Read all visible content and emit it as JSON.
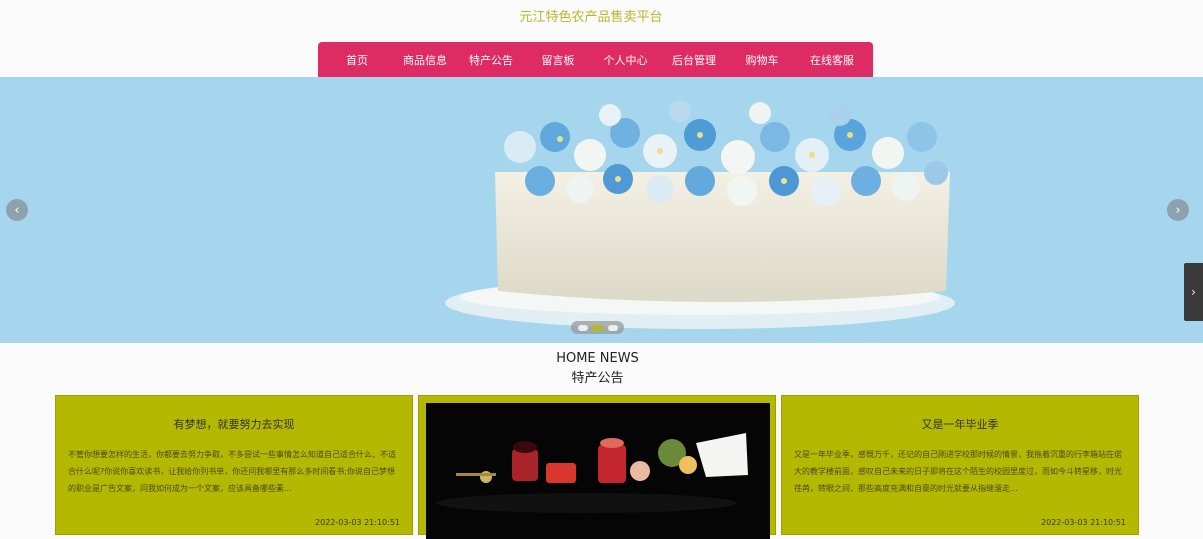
{
  "site": {
    "title": "元江特色农产品售卖平台"
  },
  "nav": {
    "items": [
      {
        "label": "首页"
      },
      {
        "label": "商品信息"
      },
      {
        "label": "特产公告"
      },
      {
        "label": "留言板"
      },
      {
        "label": "个人中心"
      },
      {
        "label": "后台管理"
      },
      {
        "label": "购物车"
      },
      {
        "label": "在线客服"
      }
    ]
  },
  "banner": {
    "prev_icon": "chevron-left-icon",
    "next_icon": "chevron-right-icon",
    "slide_count": 3,
    "active_slide": 2
  },
  "side_tab": {
    "icon": "chevron-right-icon"
  },
  "section": {
    "heading_en": "HOME NEWS",
    "heading_cn": "特产公告"
  },
  "news": [
    {
      "title": "有梦想，就要努力去实现",
      "body": "不管你想要怎样的生活，你都要去努力争取，不多尝试一些事情怎么知道自己适合什么、不适合什么呢?你说你喜欢读书，让我给你列书单，你还问我哪里有那么多时间看书;你说自己梦想的职业是广告文案，问我如何成为一个文案，应该具备哪些素...",
      "date": "2022-03-03 21:10:51"
    },
    {
      "title": "",
      "body": "",
      "date": ""
    },
    {
      "title": "又是一年毕业季",
      "body": "又是一年毕业季，感慨万千，还记的自己刚进学校那时候的情景，我拖着沉重的行李箱站在偌大的教学楼前面，感叹自己未来的日子即将在这个陌生的校园里度过，而如今斗转星移，时光荏苒，转眼之间，那些高度充满和自豪的时光就要从指缝溜走...",
      "date": "2022-03-03 21:10:51"
    }
  ],
  "colors": {
    "accent": "#df2b64",
    "brand_title": "#b5b82a",
    "card_bg": "#b5b800",
    "banner_bg": "#a6d6ee"
  }
}
